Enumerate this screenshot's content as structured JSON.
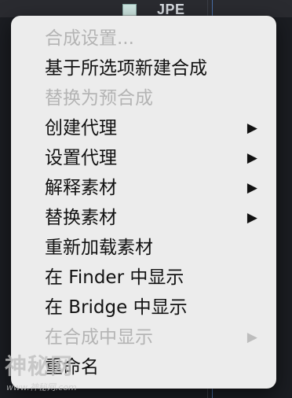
{
  "background": {
    "panel_text": "JPE"
  },
  "menu": {
    "items": [
      {
        "label": "合成设置...",
        "disabled": true,
        "submenu": false
      },
      {
        "label": "基于所选项新建合成",
        "disabled": false,
        "submenu": false
      },
      {
        "label": "替换为预合成",
        "disabled": true,
        "submenu": false
      },
      {
        "label": "创建代理",
        "disabled": false,
        "submenu": true
      },
      {
        "label": "设置代理",
        "disabled": false,
        "submenu": true
      },
      {
        "label": "解释素材",
        "disabled": false,
        "submenu": true
      },
      {
        "label": "替换素材",
        "disabled": false,
        "submenu": true
      },
      {
        "label": "重新加载素材",
        "disabled": false,
        "submenu": false
      },
      {
        "label": "在 Finder 中显示",
        "disabled": false,
        "submenu": false
      },
      {
        "label": "在 Bridge 中显示",
        "disabled": false,
        "submenu": false
      },
      {
        "label": "在合成中显示",
        "disabled": true,
        "submenu": true
      },
      {
        "label": "重命名",
        "disabled": false,
        "submenu": false
      }
    ],
    "submenu_glyph": "▶"
  },
  "watermark": {
    "text": "神秘网",
    "url": "www.神秘网.com"
  }
}
